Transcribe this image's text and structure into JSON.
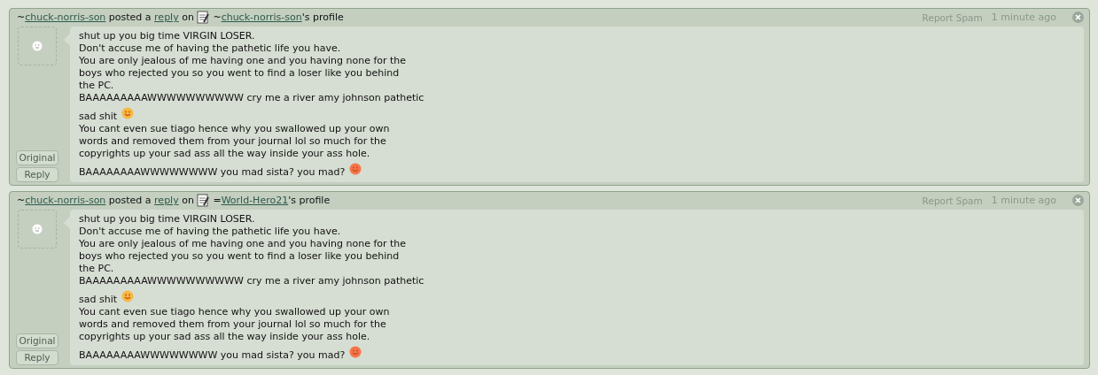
{
  "comments": [
    {
      "author_prefix": "~",
      "author": "chuck-norris-son",
      "action": " posted a ",
      "action_link": "reply",
      "on": " on ",
      "target_prefix": "~",
      "target": "chuck-norris-son",
      "target_suffix": "'s profile",
      "report": "Report Spam",
      "time": "1 minute ago",
      "buttons": [
        "Original",
        "Reply"
      ],
      "lines": [
        {
          "text": "shut up you big time VIRGIN LOSER."
        },
        {
          "text": "Don't accuse me of having the pathetic life you have."
        },
        {
          "text": "You are only jealous of me having one and you having none for the"
        },
        {
          "text": "boys who rejected you so you went to find a loser like you behind"
        },
        {
          "text": "the PC."
        },
        {
          "text": "BAAAAAAAAAWWWWWWWWWW cry me a river amy johnson pathetic"
        },
        {
          "text": "sad shit",
          "kind": "smiley",
          "color": "#f9b840"
        },
        {
          "text": "You cant even sue tiago hence why you swallowed up your own"
        },
        {
          "text": "words and removed them from your journal lol so much for the"
        },
        {
          "text": "copyrights up your sad ass all the way inside your ass hole."
        },
        {
          "text": "BAAAAAAAAWWWWWWWW you mad sista? you mad?",
          "kind": "smiley",
          "color": "#f7744a"
        }
      ]
    },
    {
      "author_prefix": "~",
      "author": "chuck-norris-son",
      "action": " posted a ",
      "action_link": "reply",
      "on": " on ",
      "target_prefix": "=",
      "target": "World-Hero21",
      "target_suffix": "'s profile",
      "report": "Report Spam",
      "time": "1 minute ago",
      "buttons": [
        "Original",
        "Reply"
      ],
      "lines": [
        {
          "text": "shut up you big time VIRGIN LOSER."
        },
        {
          "text": "Don't accuse me of having the pathetic life you have."
        },
        {
          "text": "You are only jealous of me having one and you having none for the"
        },
        {
          "text": "boys who rejected you so you went to find a loser like you behind"
        },
        {
          "text": "the PC."
        },
        {
          "text": "BAAAAAAAAAWWWWWWWWWW cry me a river amy johnson pathetic"
        },
        {
          "text": "sad shit",
          "kind": "smiley",
          "color": "#f9b840"
        },
        {
          "text": "You cant even sue tiago hence why you swallowed up your own"
        },
        {
          "text": "words and removed them from your journal lol so much for the"
        },
        {
          "text": "copyrights up your sad ass all the way inside your ass hole."
        },
        {
          "text": "BAAAAAAAAWWWWWWWW you mad sista? you mad?",
          "kind": "smiley",
          "color": "#f7744a"
        }
      ]
    }
  ]
}
